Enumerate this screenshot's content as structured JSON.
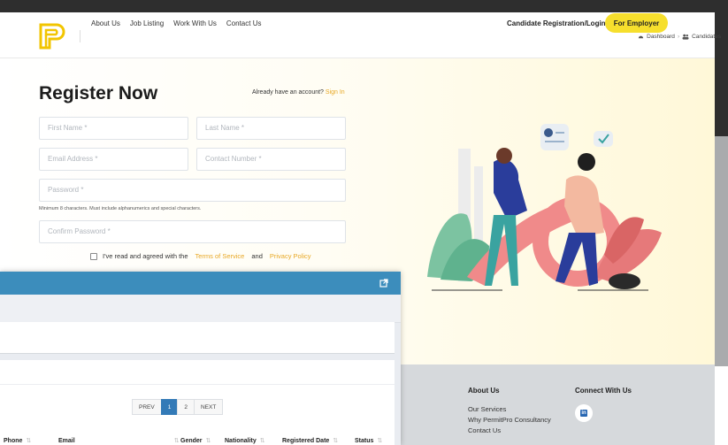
{
  "nav": {
    "links": [
      "About Us",
      "Job Listing",
      "Work With Us",
      "Contact Us"
    ],
    "candidate_link": "Candidate Registration/Login",
    "employer_button": "For Employer"
  },
  "register": {
    "title": "Register Now",
    "already_text": "Already have an account?",
    "signin_link": "Sign In",
    "fields": {
      "first_name": "First Name *",
      "last_name": "Last Name *",
      "email": "Email Address *",
      "contact": "Contact Number *",
      "password": "Password *",
      "confirm_password": "Confirm Password *"
    },
    "password_hint": "Minimum 8 characters. Must include alphanumerics and special characters.",
    "agree_text": "I've read and agreed with the",
    "terms_link": "Terms of Service",
    "and_text": "and",
    "privacy_link": "Privacy Policy"
  },
  "footer": {
    "about_heading": "About Us",
    "about_items": [
      "Our Services",
      "Why PermitPro Consultancy",
      "Contact Us"
    ],
    "connect_heading": "Connect With Us"
  },
  "admin": {
    "breadcrumb": [
      "Dashboard",
      "Candidates"
    ],
    "pagination": [
      "PREV",
      "1",
      "2",
      "NEXT"
    ],
    "active_page": "1",
    "columns": [
      "Phone",
      "Email",
      "Gender",
      "Nationality",
      "Registered Date",
      "Status"
    ]
  },
  "colors": {
    "accent_yellow": "#f6df2d",
    "link_orange": "#e8a825",
    "admin_blue": "#3c8dbc"
  }
}
